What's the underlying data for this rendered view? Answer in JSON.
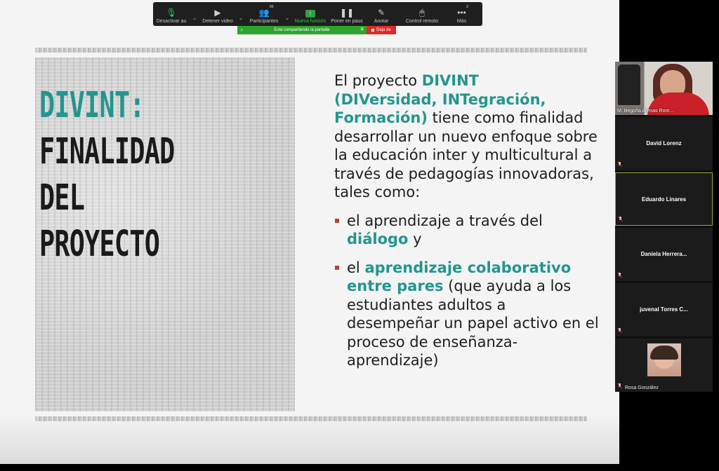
{
  "toolbar": {
    "mute_label": "Desactivar au",
    "video_label": "Detener video",
    "participants_label": "Participantes",
    "participants_count": "56",
    "new_feature_label": "Nueva función",
    "pause_label": "Poner en paus",
    "annotate_label": "Anotar",
    "remote_label": "Control remoto",
    "more_label": "Más",
    "more_count": "3"
  },
  "share_bar": {
    "sharing_text": "Está compartiendo la pantalla",
    "stop_label": "Deja de"
  },
  "slide": {
    "title_lines": [
      "DIVINT:",
      "FINALIDAD",
      "DEL",
      "PROYECTO"
    ],
    "intro": {
      "part1": "El proyecto ",
      "divint": "DIVINT",
      "expansion": "(DIVersidad, INTegración, Formación)",
      "part2": " tiene como finalidad desarrollar un nuevo enfoque sobre la educación inter y multicultural a través de pedagogías innovadoras, tales como:"
    },
    "bullet1": {
      "text1": "el aprendizaje a través del ",
      "highlight": "diálogo",
      "text2": " y"
    },
    "bullet2": {
      "text1": "el ",
      "highlight": "aprendizaje colaborativo entre pares",
      "text2": " (que ayuda a los estudiantes adultos a desempeñar un papel activo en el proceso de enseñanza-aprendizaje)"
    }
  },
  "participants": [
    {
      "name": "M. Begoña Arenas Rom..."
    },
    {
      "name": "David Lorenz"
    },
    {
      "name": "Eduardo Linares"
    },
    {
      "name": "Daniela  Herrera..."
    },
    {
      "name": "juvenal  Torres  C..."
    },
    {
      "name": "Rosa González"
    }
  ],
  "colors": {
    "accent": "#23958f",
    "bullet": "#b5442a",
    "share_green": "#2ca52c",
    "stop_red": "#e02828",
    "active_border": "#8fb02c"
  }
}
